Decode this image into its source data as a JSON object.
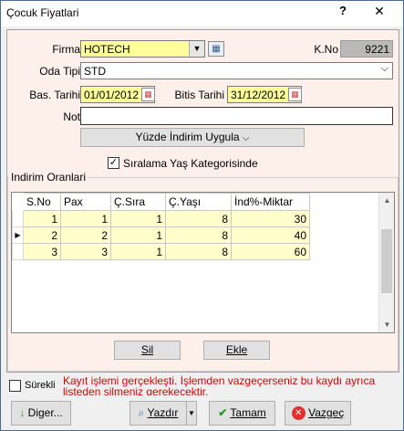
{
  "window": {
    "title": "Çocuk Fiyatlari",
    "help": "?",
    "close": "✕"
  },
  "form": {
    "firma_label": "Firma",
    "firma_value": "HOTECH",
    "kno_label": "K.No",
    "kno_value": "9221",
    "oda_label": "Oda Tipi",
    "oda_value": "STD",
    "bas_label": "Bas. Tarihi",
    "bas_value": "01/01/2012",
    "bitis_label": "Bitis Tarihi",
    "bitis_value": "31/12/2012",
    "not_label": "Not",
    "not_value": "",
    "indirim_button": "Yüzde İndirim Uygula",
    "siralama_label": "Sıralama Yaş Kategorisinde",
    "siralama_checked": true
  },
  "group": {
    "title": "Indirim Oranlari",
    "columns": [
      "S.No",
      "Pax",
      "Ç.Sıra",
      "Ç.Yaşı",
      "İnd%-Miktar"
    ],
    "rows": [
      [
        "1",
        "1",
        "1",
        "8",
        "30"
      ],
      [
        "2",
        "2",
        "1",
        "8",
        "40"
      ],
      [
        "3",
        "3",
        "1",
        "8",
        "60"
      ]
    ],
    "sil": "Sil",
    "ekle": "Ekle"
  },
  "status": {
    "surekli_label": "Sürekli",
    "message": "Kayıt işlemi gerçekleşti. İşlemden vazgeçerseniz bu kaydı ayrıca listeden silmeniz gerekecektir."
  },
  "footer": {
    "diger": "Diger...",
    "yazdir": "Yazdır",
    "tamam": "Tamam",
    "vazgec": "Vazgeç"
  }
}
